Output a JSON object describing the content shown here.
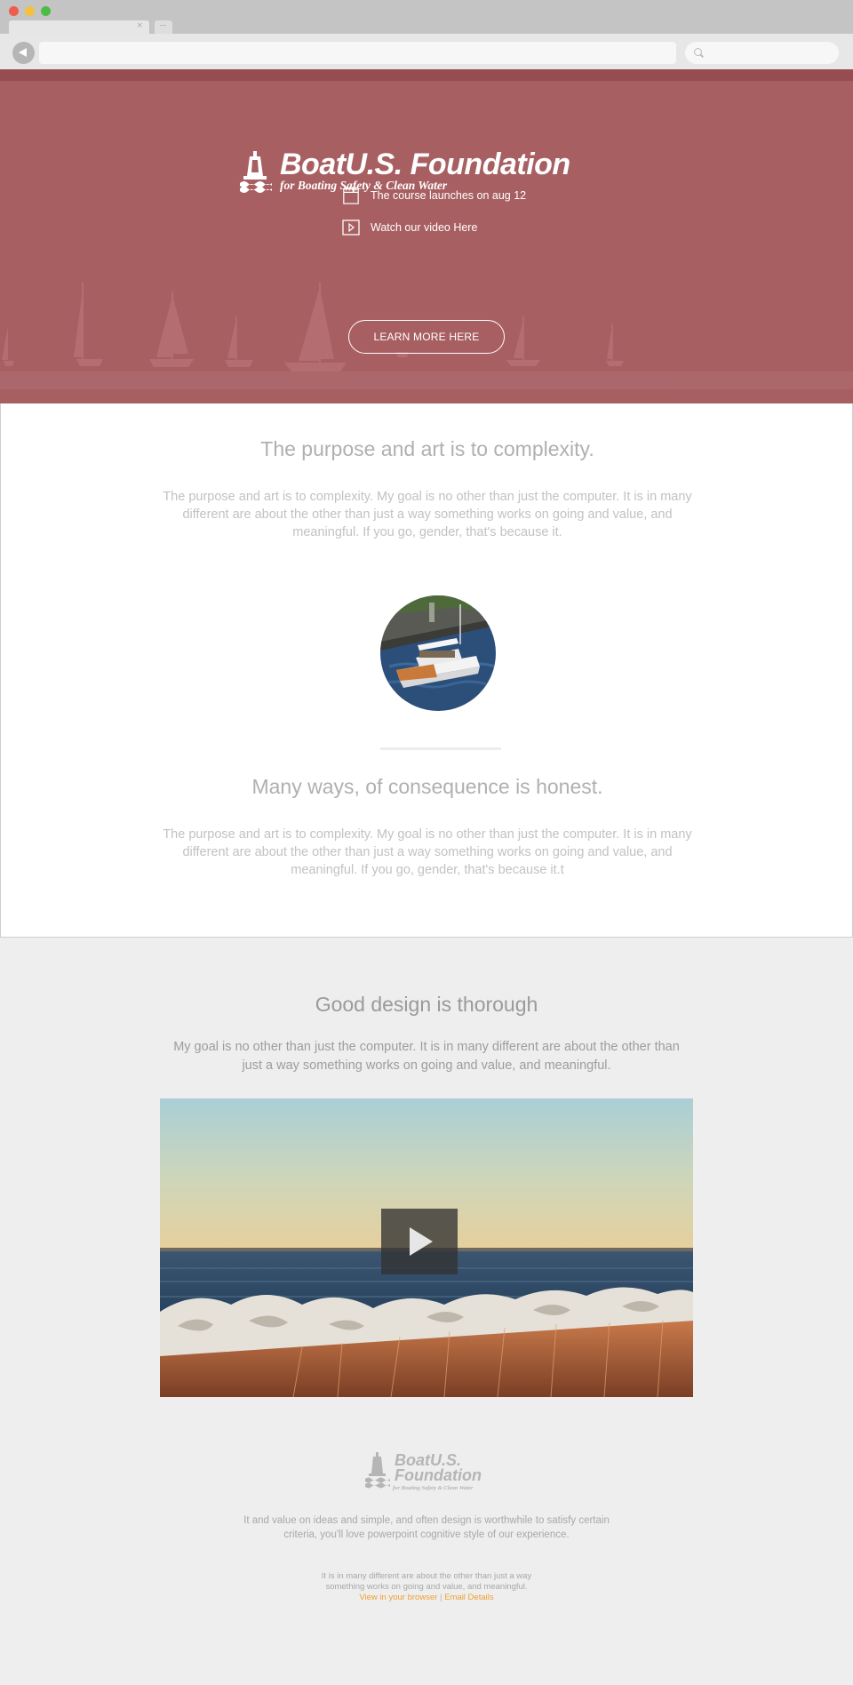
{
  "browser": {
    "traffic_lights": [
      "#f05c4f",
      "#f5c03b",
      "#4cbc46"
    ],
    "tab_close": "×"
  },
  "hero": {
    "bg_color": "#a85f62",
    "logo_title": "BoatU.S. Foundation",
    "logo_subtitle": "for Boating Safety & Clean Water",
    "info_items": [
      {
        "icon": "calendar-icon",
        "text": "The course launches on aug 12"
      },
      {
        "icon": "play-square-icon",
        "text": "Watch our video Here"
      }
    ],
    "cta_label": "LEARN MORE HERE"
  },
  "content": {
    "section1_title": "The purpose and art is to complexity.",
    "section1_text": "The purpose and art is to complexity. My goal is no other than just the computer. It is in many different are about the other than just a way something works on going and value, and meaningful. If you go, gender, that's because it.",
    "section2_title": "Many ways, of consequence is honest.",
    "section2_text": "The purpose and art is to complexity. My goal is no other than just the computer. It is in many different are about the other than just a way something works on going and value, and meaningful. If you go, gender, that's because it.t"
  },
  "feature": {
    "title": "Good design is thorough",
    "text": "My goal is no other than just the computer. It is in many different are about the other than just a way something works on going and value, and meaningful."
  },
  "footer": {
    "logo_line1": "BoatU.S.",
    "logo_line2": "Foundation",
    "logo_line3": "for Boating Safety & Clean Water",
    "text": "It and value on ideas and simple, and often design is worthwhile to satisfy certain criteria, you'll love powerpoint cognitive style of our experience.",
    "small_text": "It is in many different are about the other than just a way something works on going and value, and meaningful.",
    "link_browser": "View in your browser",
    "link_separator": "|",
    "link_email": "Email Details",
    "link_color": "#f0a030"
  }
}
